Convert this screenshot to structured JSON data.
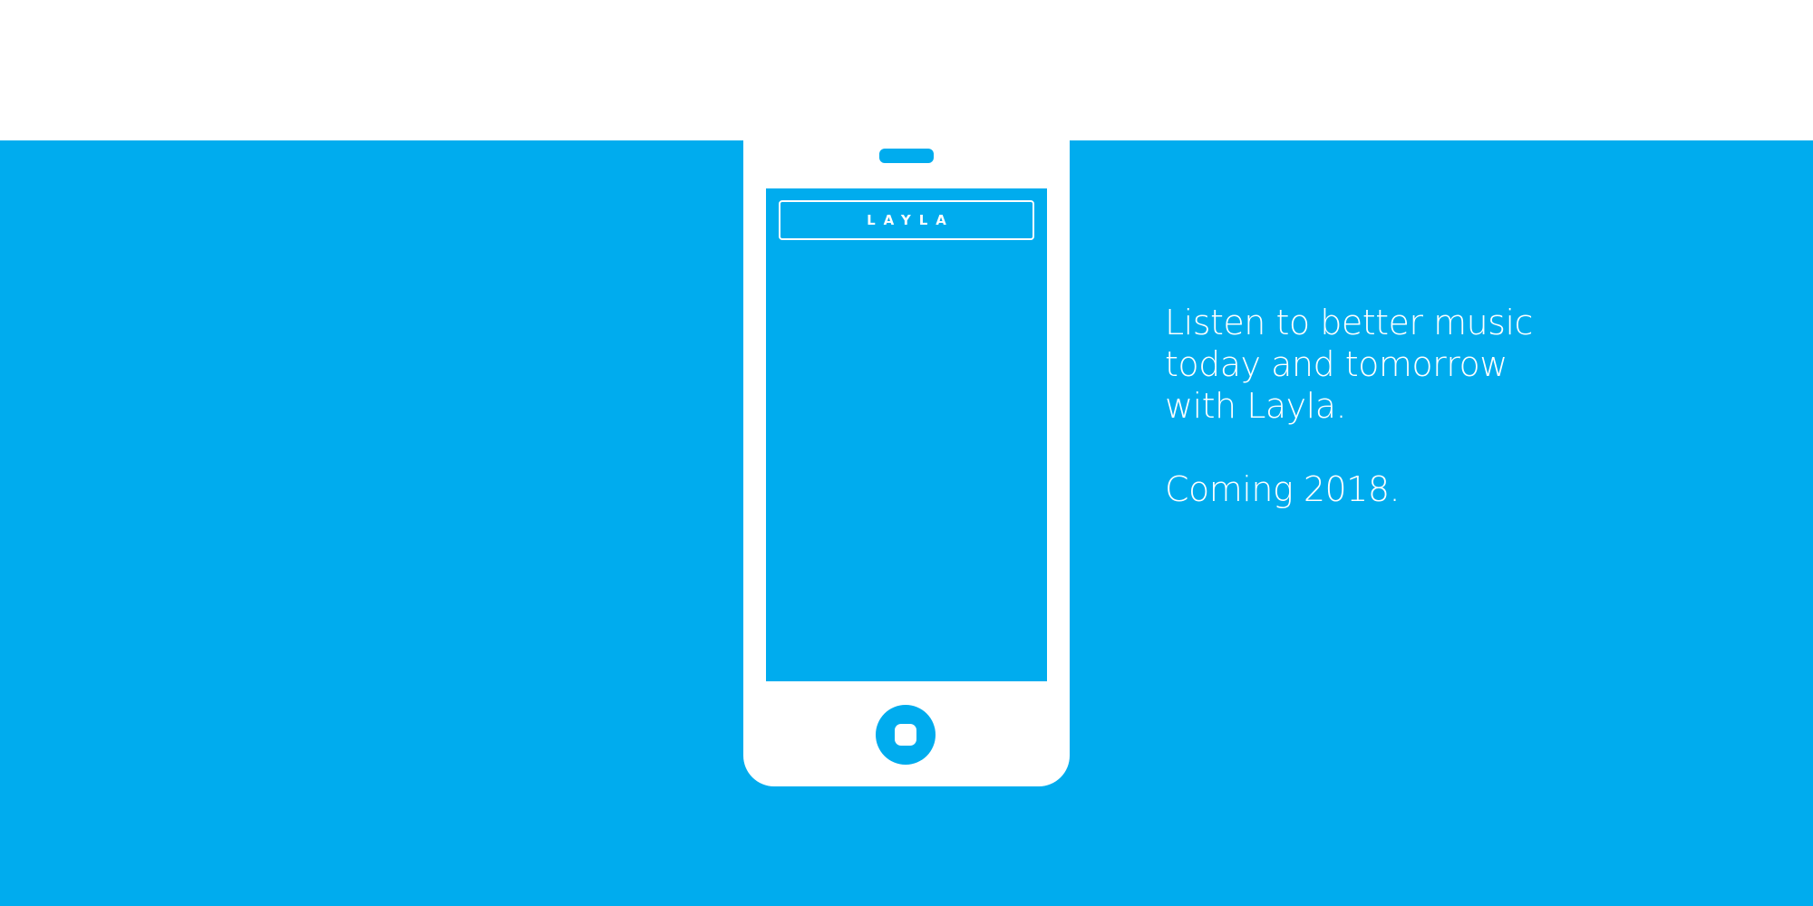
{
  "colors": {
    "brand_blue": "#00acee",
    "white": "#ffffff"
  },
  "phone": {
    "app_title": "LAYLA",
    "speaker_icon": "phone-speaker-icon",
    "home_icon": "home-button-icon"
  },
  "hero": {
    "tagline_lines": [
      "Listen to better music",
      "today and tomorrow",
      "with Layla."
    ],
    "coming": "Coming 2018."
  }
}
